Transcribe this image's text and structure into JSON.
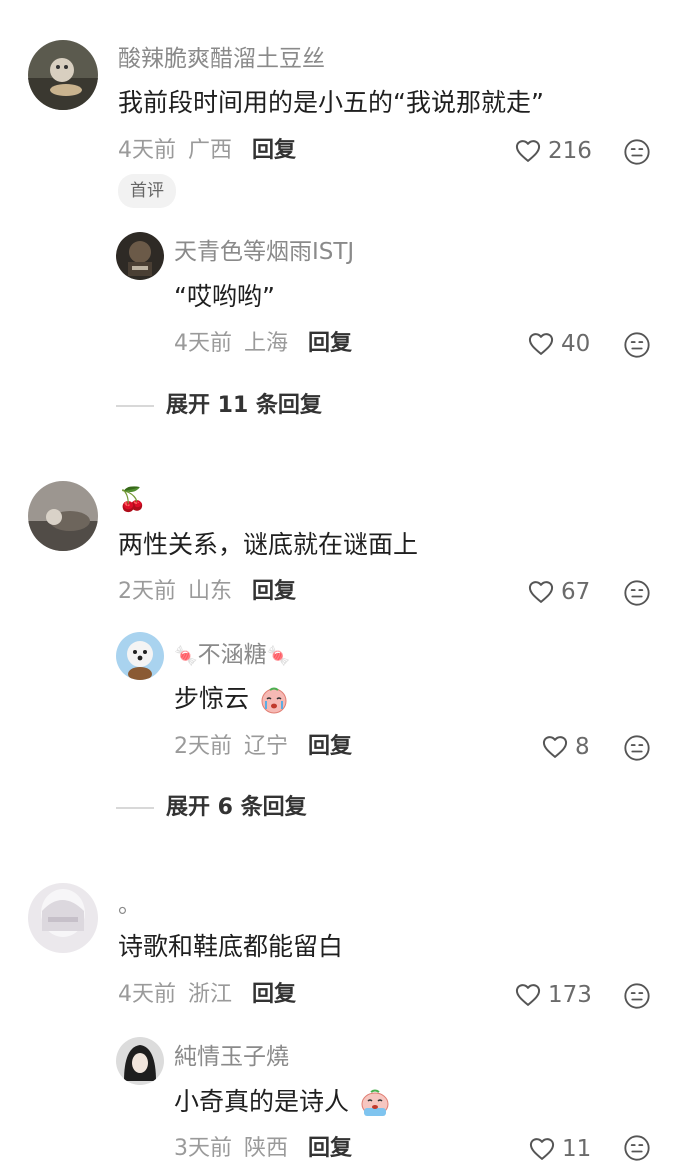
{
  "comments": [
    {
      "username": "酸辣脆爽醋溜土豆丝",
      "text": "我前段时间用的是小五的“我说那就走”",
      "time": "4天前",
      "location": "广西",
      "reply_label": "回复",
      "likes": "216",
      "badge": "首评",
      "reply": {
        "username": "天青色等烟雨ISTJ",
        "text": "“哎哟哟”",
        "time": "4天前",
        "location": "上海",
        "reply_label": "回复",
        "likes": "40"
      },
      "expand_label": "展开 11 条回复"
    },
    {
      "username": "🍒",
      "text": "两性关系，谜底就在谜面上",
      "time": "2天前",
      "location": "山东",
      "reply_label": "回复",
      "likes": "67",
      "reply": {
        "username_prefix": "🍬",
        "username": "不涵糖",
        "username_suffix": "🍬",
        "text": "步惊云",
        "time": "2天前",
        "location": "辽宁",
        "reply_label": "回复",
        "likes": "8"
      },
      "expand_label": "展开 6 条回复"
    },
    {
      "username": "。",
      "text": "诗歌和鞋底都能留白",
      "time": "4天前",
      "location": "浙江",
      "reply_label": "回复",
      "likes": "173",
      "reply": {
        "username": "純情玉子燒",
        "text": "小奇真的是诗人",
        "time": "3天前",
        "location": "陕西",
        "reply_label": "回复",
        "likes": "11"
      }
    }
  ],
  "icons": {
    "like": "heart-outline-icon",
    "dislike": "neutral-face-icon"
  },
  "colors": {
    "meta_text": "#9a9a9a",
    "name_text": "#8a8a8a",
    "badge_bg": "#f2f2f2"
  }
}
